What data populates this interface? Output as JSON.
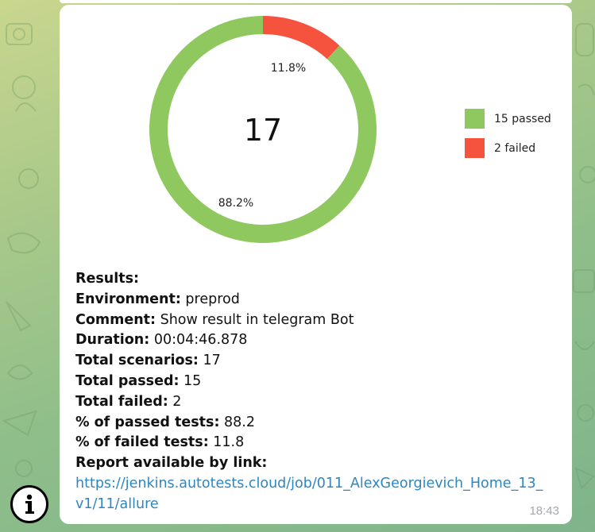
{
  "message": {
    "time": "18:43",
    "results_heading": "Results:",
    "fields": [
      {
        "label": "Environment:",
        "value": " preprod"
      },
      {
        "label": "Comment:",
        "value": " Show result in telegram Bot"
      },
      {
        "label": "Duration:",
        "value": " 00:04:46.878"
      },
      {
        "label": "Total scenarios:",
        "value": " 17"
      },
      {
        "label": "Total passed:",
        "value": " 15"
      },
      {
        "label": "Total failed:",
        "value": " 2"
      },
      {
        "label": "% of passed tests:",
        "value": " 88.2"
      },
      {
        "label": "% of failed tests:",
        "value": " 11.8"
      }
    ],
    "report_label": "Report available by link:",
    "report_link_line1": "https://jenkins.autotests.cloud/job/011_AlexGeorgievich_Home_13_",
    "report_link_line2": "v1/11/allure"
  },
  "chart_data": {
    "type": "pie",
    "center_label": "17",
    "slices": [
      {
        "label": "15 passed",
        "value": 15,
        "percent_label": "88.2%",
        "color": "#8fc85f"
      },
      {
        "label": "2 failed",
        "value": 2,
        "percent_label": "11.8%",
        "color": "#f6533f"
      }
    ],
    "legend_placement": "right"
  },
  "colors": {
    "passed": "#8fc85f",
    "failed": "#f6533f",
    "link": "#2e86c1"
  },
  "icons": {
    "info": "info-icon"
  }
}
